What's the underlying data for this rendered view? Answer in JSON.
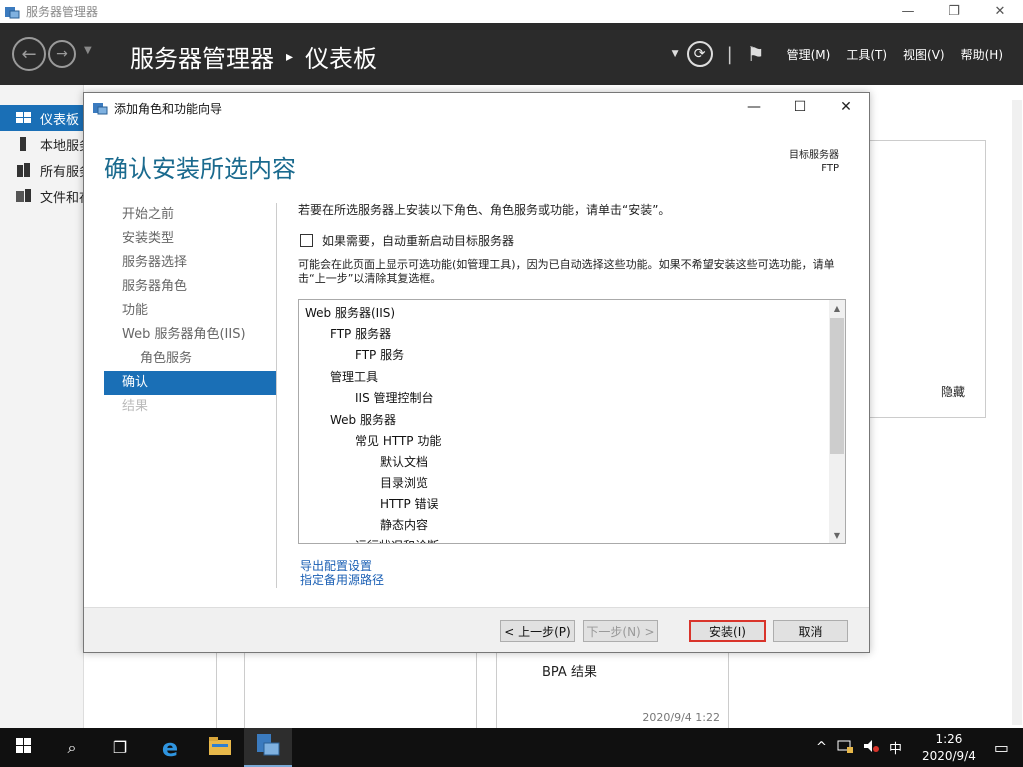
{
  "window": {
    "title": "服务器管理器",
    "controls": {
      "minimize": "—",
      "restore": "❐",
      "close": "✕"
    }
  },
  "header": {
    "breadcrumb": [
      "服务器管理器",
      "仪表板"
    ],
    "separator": "▸",
    "menus": [
      "管理(M)",
      "工具(T)",
      "视图(V)",
      "帮助(H)"
    ],
    "back_glyph": "←",
    "forward_glyph": "→",
    "refresh_glyph": "⟳",
    "flag_glyph": "⚑"
  },
  "sidebar": {
    "items": [
      {
        "label": "仪表板",
        "icon": "dashboard-icon",
        "active": true
      },
      {
        "label": "本地服务器",
        "icon": "local-server-icon",
        "active": false
      },
      {
        "label": "所有服务器",
        "icon": "all-servers-icon",
        "active": false
      },
      {
        "label": "文件和存储服务",
        "icon": "file-storage-icon",
        "active": false
      }
    ]
  },
  "background": {
    "hide_label": "隐藏",
    "bpa_label": "BPA 结果",
    "timestamp": "2020/9/4 1:22"
  },
  "dialog": {
    "title": "添加角色和功能向导",
    "controls": {
      "minimize": "—",
      "maximize": "☐",
      "close": "✕"
    },
    "page_title": "确认安装所选内容",
    "target_server_label": "目标服务器",
    "target_server": "FTP",
    "steps": [
      {
        "label": "开始之前",
        "state": "normal",
        "sub": false
      },
      {
        "label": "安装类型",
        "state": "normal",
        "sub": false
      },
      {
        "label": "服务器选择",
        "state": "normal",
        "sub": false
      },
      {
        "label": "服务器角色",
        "state": "normal",
        "sub": false
      },
      {
        "label": "功能",
        "state": "normal",
        "sub": false
      },
      {
        "label": "Web 服务器角色(IIS)",
        "state": "normal",
        "sub": false
      },
      {
        "label": "角色服务",
        "state": "normal",
        "sub": true
      },
      {
        "label": "确认",
        "state": "active",
        "sub": false
      },
      {
        "label": "结果",
        "state": "disabled",
        "sub": false
      }
    ],
    "intro": "若要在所选服务器上安装以下角色、角色服务或功能，请单击“安装”。",
    "restart_label": "如果需要，自动重新启动目标服务器",
    "restart_checked": false,
    "note": "可能会在此页面上显示可选功能(如管理工具)，因为已自动选择这些功能。如果不希望安装这些可选功能，请单击“上一步”以清除其复选框。",
    "features": [
      {
        "label": "Web 服务器(IIS)",
        "level": 0
      },
      {
        "label": "FTP 服务器",
        "level": 1
      },
      {
        "label": "FTP 服务",
        "level": 2
      },
      {
        "label": "管理工具",
        "level": 1
      },
      {
        "label": "IIS 管理控制台",
        "level": 2
      },
      {
        "label": "Web 服务器",
        "level": 1
      },
      {
        "label": "常见 HTTP 功能",
        "level": 2
      },
      {
        "label": "默认文档",
        "level": 3
      },
      {
        "label": "目录浏览",
        "level": 3
      },
      {
        "label": "HTTP 错误",
        "level": 3
      },
      {
        "label": "静态内容",
        "level": 3
      },
      {
        "label": "运行状况和诊断",
        "level": 2
      }
    ],
    "links": [
      "导出配置设置",
      "指定备用源路径"
    ],
    "buttons": {
      "prev": "< 上一步(P)",
      "next": "下一步(N) >",
      "install": "安装(I)",
      "cancel": "取消"
    }
  },
  "taskbar": {
    "start_glyph": "⊞",
    "search_glyph": "⌕",
    "taskview_glyph": "❐",
    "ie_glyph": "e",
    "explorer_glyph": "▬",
    "tray_up": "^",
    "ime": "中",
    "time": "1:26",
    "date": "2020/9/4",
    "notif_glyph": "▭"
  }
}
